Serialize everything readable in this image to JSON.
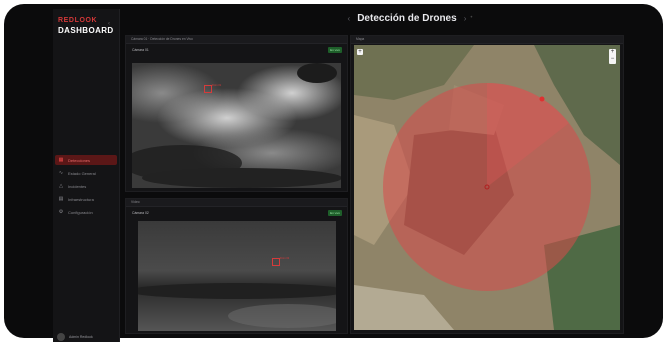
{
  "sidebar": {
    "logo_line1": "REDLOOK",
    "logo_line2": "DASHBOARD",
    "collapse_icon": "chevron-icon",
    "items": [
      {
        "label": "Detecciones",
        "icon": "grid-icon",
        "active": true
      },
      {
        "label": "Estado General",
        "icon": "activity-icon",
        "active": false
      },
      {
        "label": "Incidentes",
        "icon": "alert-icon",
        "active": false
      },
      {
        "label": "Infraestructura",
        "icon": "server-icon",
        "active": false
      },
      {
        "label": "Configuración",
        "icon": "gear-icon",
        "active": false
      }
    ],
    "user_name": "Admin Redlook"
  },
  "header": {
    "title": "Detección de Drones"
  },
  "panels": {
    "camera1": {
      "header": "Cámara 01 · Detección de Drones en Vivo",
      "sub_label": "Cámara 01",
      "badge": "En vivo",
      "target_label": "Dron 01"
    },
    "camera2": {
      "header": "Vídeo",
      "sub_label": "Cámara 02",
      "badge": "En vivo",
      "target_label": "Dron 02"
    },
    "map": {
      "header": "Mapa",
      "zoom_in": "+",
      "zoom_out": "−",
      "expand": "+"
    }
  },
  "colors": {
    "accent": "#d23838",
    "active_bg": "#5b1717",
    "live_badge": "#1e5f2a",
    "zone": "#d94a4a"
  }
}
